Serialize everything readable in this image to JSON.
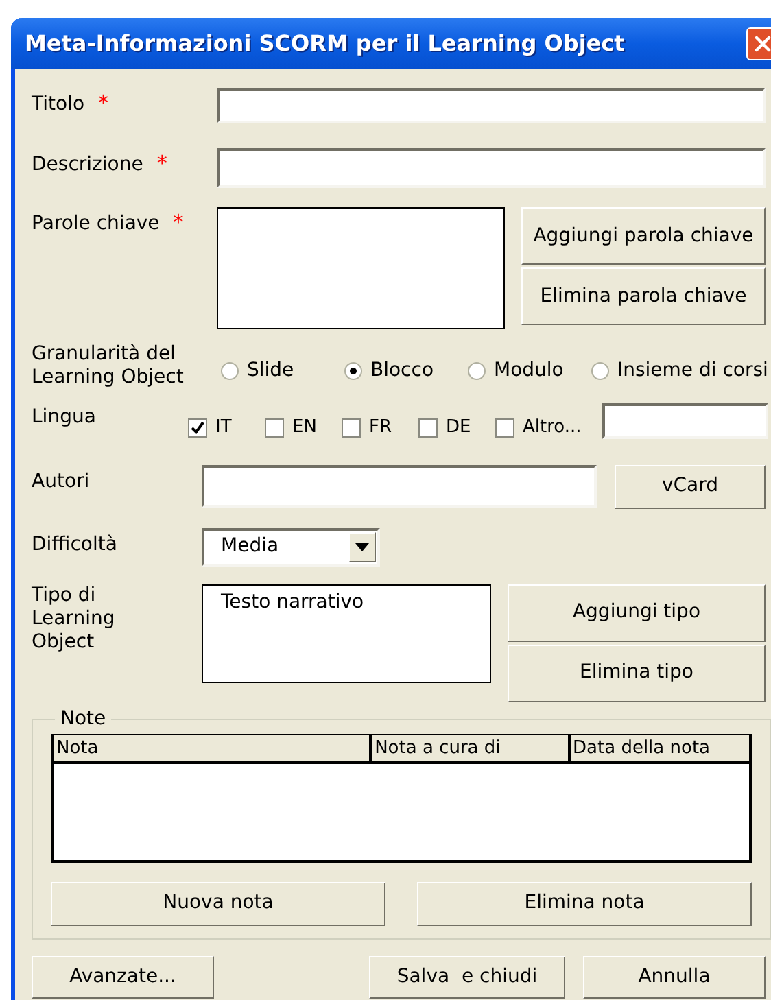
{
  "window": {
    "title": "Meta-Informazioni SCORM per il Learning Object"
  },
  "titolo": {
    "label": "Titolo",
    "required_mark": "*"
  },
  "descrizione": {
    "label": "Descrizione",
    "required_mark": "*"
  },
  "parole_chiave": {
    "label": "Parole chiave",
    "required_mark": "*",
    "buttons": [
      "Aggiungi parola chiave",
      "Elimina parola chiave"
    ]
  },
  "granularita": {
    "label": "Granularità del Learning Object",
    "options": [
      {
        "label": "Slide",
        "selected": false
      },
      {
        "label": "Blocco",
        "selected": true
      },
      {
        "label": "Modulo",
        "selected": false
      },
      {
        "label": "Insieme di corsi",
        "selected": false
      }
    ]
  },
  "lingua": {
    "label": "Lingua",
    "options": [
      {
        "label": "IT",
        "checked": true
      },
      {
        "label": "EN",
        "checked": false
      },
      {
        "label": "FR",
        "checked": false
      },
      {
        "label": "DE",
        "checked": false
      },
      {
        "label": "Altro...",
        "checked": false
      }
    ]
  },
  "autori": {
    "label": "Autori",
    "button": "vCard"
  },
  "difficolta": {
    "label": "Difficoltà",
    "value": "Media"
  },
  "tipo": {
    "label": "Tipo di Learning Object",
    "items": [
      "Testo narrativo"
    ],
    "buttons": [
      "Aggiungi tipo",
      "Elimina tipo"
    ]
  },
  "note": {
    "title": "Note",
    "columns": [
      "Nota",
      "Nota a cura di",
      "Data della nota"
    ],
    "buttons": [
      "Nuova nota",
      "Elimina nota"
    ]
  },
  "footer_buttons": [
    "Avanzate...",
    "Salva  e chiudi",
    "Annulla"
  ]
}
